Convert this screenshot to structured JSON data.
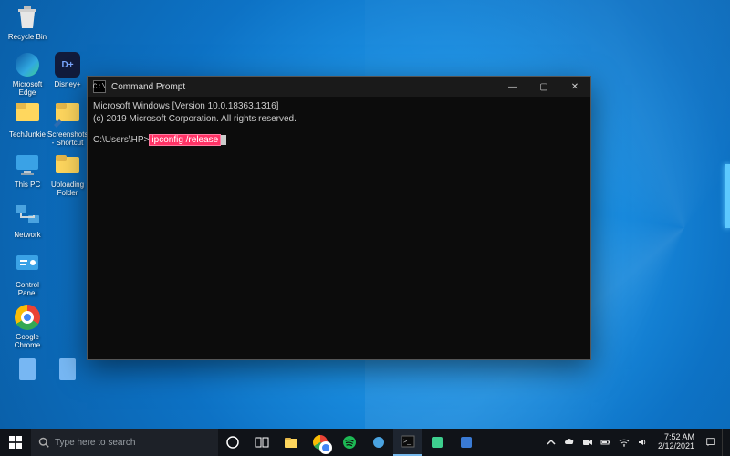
{
  "desktop_icons": {
    "recycle_bin": "Recycle Bin",
    "edge": "Microsoft Edge",
    "disney": "Disney+",
    "techjunkie": "TechJunkie",
    "screenshot_shortcut": "Screenshots - Shortcut",
    "this_pc": "This PC",
    "uploading_folder": "Uploading Folder",
    "network": "Network",
    "control_panel": "Control Panel",
    "chrome": "Google Chrome"
  },
  "cmd": {
    "title": "Command Prompt",
    "line1": "Microsoft Windows [Version 10.0.18363.1316]",
    "line2": "(c) 2019 Microsoft Corporation. All rights reserved.",
    "prompt": "C:\\Users\\HP>",
    "command": "ipconfig /release",
    "min": "—",
    "max": "▢",
    "close": "✕"
  },
  "taskbar": {
    "search_placeholder": "Type here to search",
    "time": "7:52 AM",
    "date": "2/12/2021"
  }
}
